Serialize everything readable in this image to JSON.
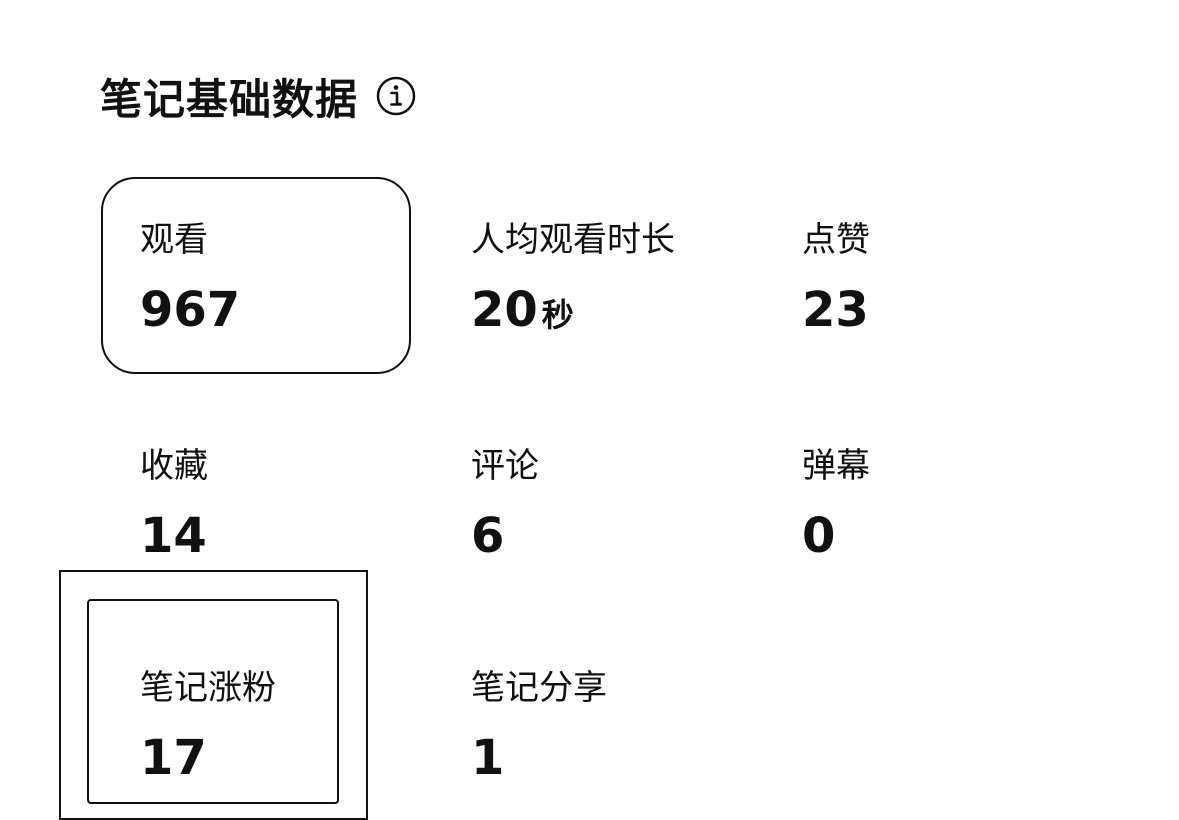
{
  "header": {
    "title": "笔记基础数据"
  },
  "stats": {
    "views": {
      "label": "观看",
      "value": "967"
    },
    "avg_watch_time": {
      "label": "人均观看时长",
      "value": "20",
      "unit": "秒"
    },
    "likes": {
      "label": "点赞",
      "value": "23"
    },
    "favorites": {
      "label": "收藏",
      "value": "14"
    },
    "comments": {
      "label": "评论",
      "value": "6"
    },
    "danmaku": {
      "label": "弹幕",
      "value": "0"
    },
    "followers_gained": {
      "label": "笔记涨粉",
      "value": "17"
    },
    "shares": {
      "label": "笔记分享",
      "value": "1"
    }
  }
}
